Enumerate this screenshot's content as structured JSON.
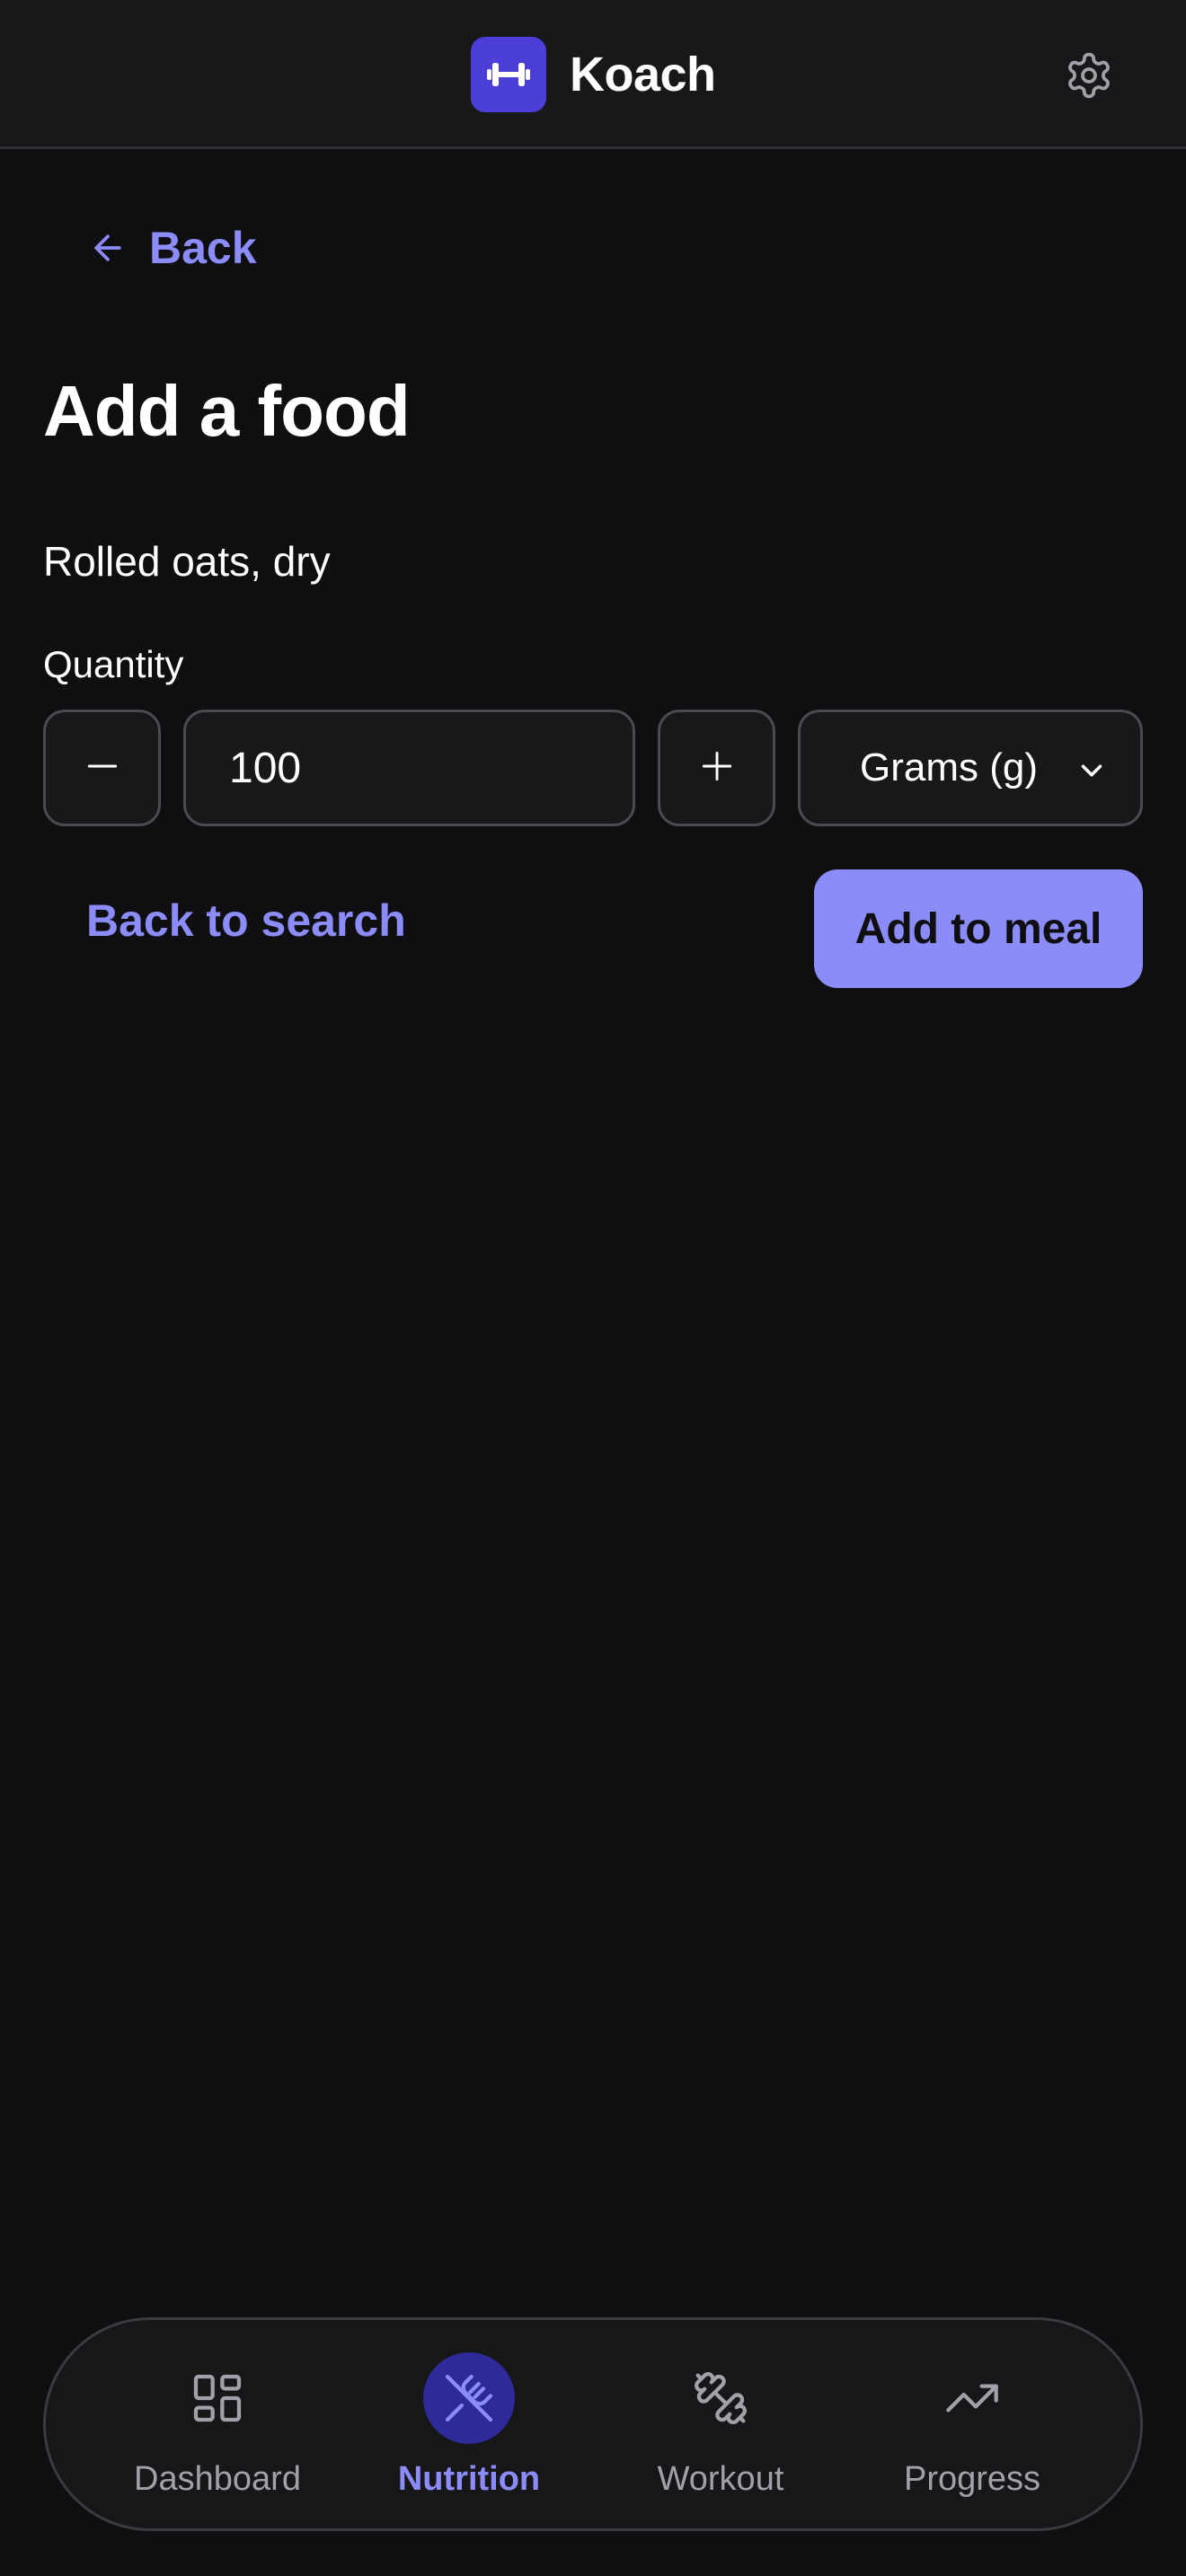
{
  "app": {
    "name": "Koach"
  },
  "nav": {
    "back_label": "Back"
  },
  "page": {
    "title": "Add a food"
  },
  "food": {
    "name": "Rolled oats, dry"
  },
  "quantity": {
    "label": "Quantity",
    "value": "100",
    "decrement_icon": "minus-icon",
    "increment_icon": "plus-icon",
    "unit": "Grams (g)"
  },
  "actions": {
    "back_to_search": "Back to search",
    "add_to_meal": "Add to meal"
  },
  "bottom_nav": {
    "items": [
      {
        "label": "Dashboard",
        "icon": "dashboard-icon",
        "active": false
      },
      {
        "label": "Nutrition",
        "icon": "utensils-icon",
        "active": true
      },
      {
        "label": "Workout",
        "icon": "dumbbell-icon",
        "active": false
      },
      {
        "label": "Progress",
        "icon": "trending-up-icon",
        "active": false
      }
    ]
  },
  "colors": {
    "background": "#0f0f11",
    "header": "#18181b",
    "accent": "#8b8cf8",
    "logo": "#4b3fd8",
    "active_nav_bg": "#2e2a9a"
  }
}
